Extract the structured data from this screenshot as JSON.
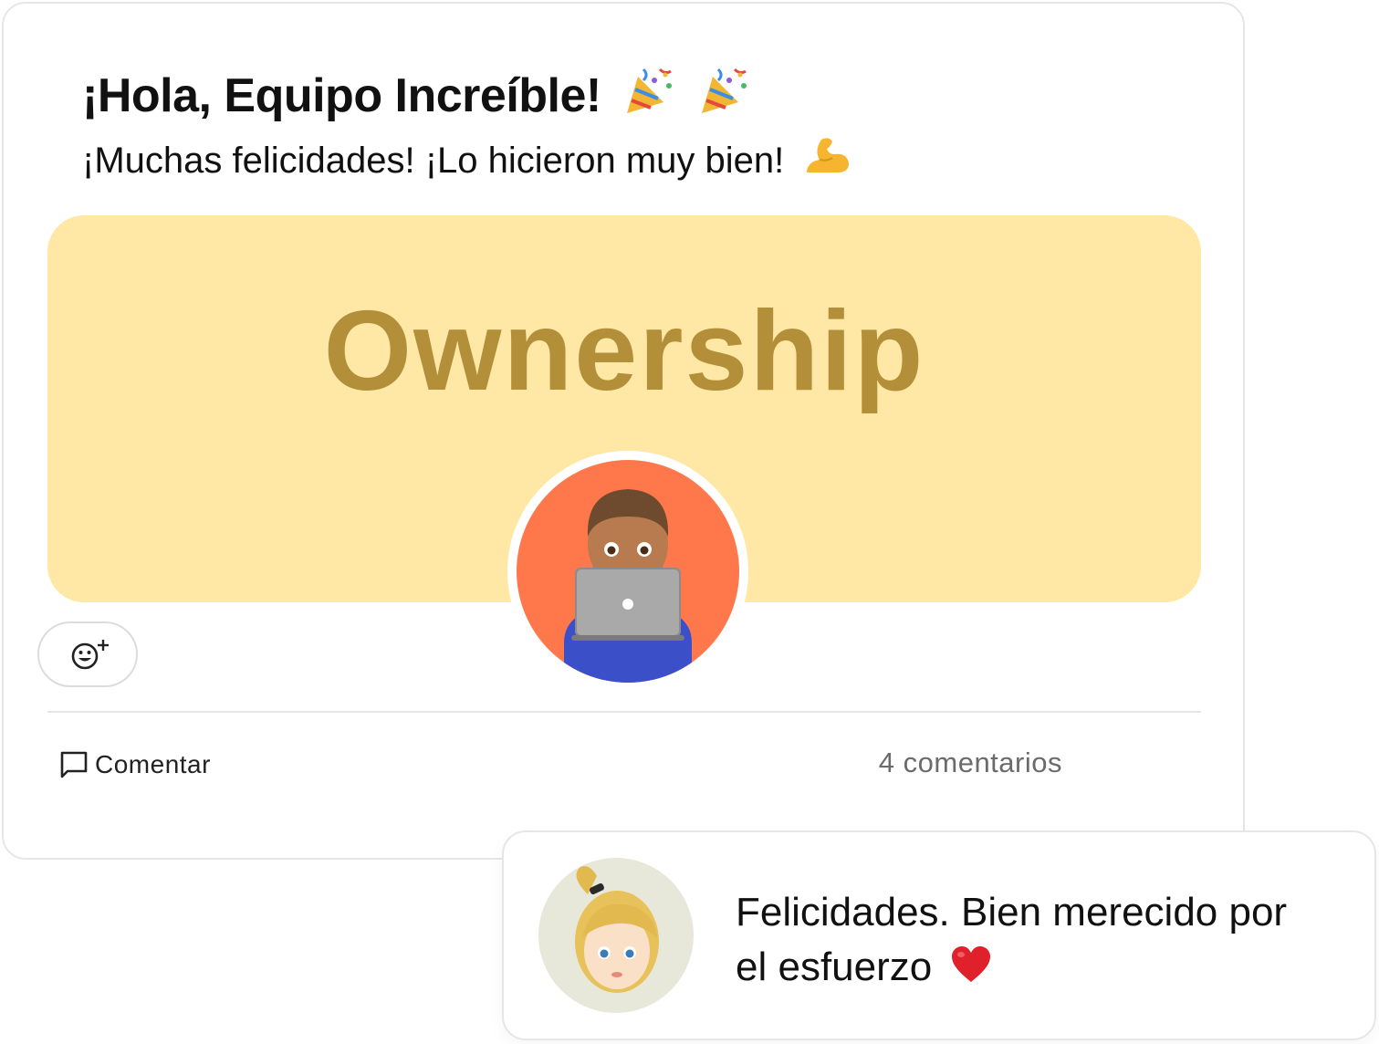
{
  "post": {
    "title": "¡Hola, Equipo Increíble!",
    "title_icons": [
      "party-popper-icon",
      "party-popper-icon"
    ],
    "subtitle": "¡Muchas felicidades! ¡Lo hicieron muy bien!",
    "subtitle_icon": "flexed-biceps-icon",
    "banner": {
      "word": "Ownership",
      "background": "#ffe8a6",
      "word_color": "#b28f38",
      "avatar_icon": "technologist-icon",
      "avatar_background": "#ff784b"
    },
    "reaction_button_icon": "add-reaction-icon",
    "actions": {
      "comment_label": "Comentar",
      "comment_icon": "comment-bubble-icon",
      "comments_count": "4 comentarios"
    }
  },
  "comment": {
    "avatar_icon": "blonde-woman-icon",
    "avatar_background": "#e7e8da",
    "text": "Felicidades. Bien merecido por el esfuerzo",
    "trailing_icon": "red-heart-icon"
  }
}
